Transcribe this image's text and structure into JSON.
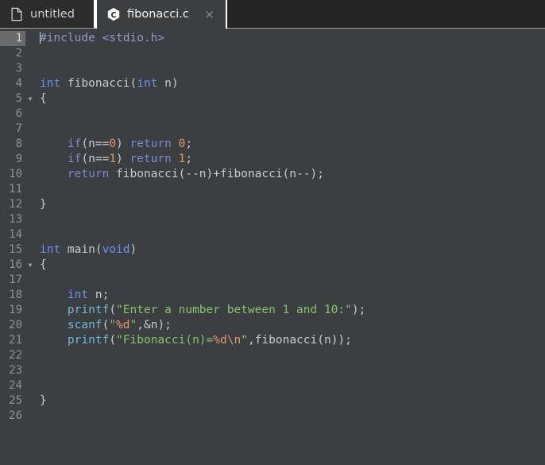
{
  "window": {
    "accent_white": "#ffffff",
    "tabbar_bg": "#252526",
    "editor_bg": "#3c3f41"
  },
  "tabs": [
    {
      "label": "untitled",
      "icon": "document-icon",
      "active": false,
      "has_close": false
    },
    {
      "label": "fibonacci.c",
      "icon": "c-file-hex-icon",
      "active": true,
      "has_close": true,
      "close_label": "×"
    }
  ],
  "editor": {
    "language": "c",
    "current_line": 1,
    "total_lines": 26,
    "cursor": {
      "line": 1,
      "column": 1
    },
    "fold_lines": [
      5,
      16
    ],
    "lines": [
      {
        "n": 1,
        "fold": false,
        "tokens": [
          {
            "t": "#include",
            "c": "pre"
          },
          {
            "t": " ",
            "c": "pl"
          },
          {
            "t": "<stdio.h>",
            "c": "pre"
          }
        ]
      },
      {
        "n": 2,
        "fold": false,
        "tokens": []
      },
      {
        "n": 3,
        "fold": false,
        "tokens": []
      },
      {
        "n": 4,
        "fold": false,
        "tokens": [
          {
            "t": "int",
            "c": "k"
          },
          {
            "t": " fibonacci(",
            "c": "pl"
          },
          {
            "t": "int",
            "c": "k"
          },
          {
            "t": " n)",
            "c": "pl"
          }
        ]
      },
      {
        "n": 5,
        "fold": true,
        "tokens": [
          {
            "t": "{",
            "c": "pl"
          }
        ]
      },
      {
        "n": 6,
        "fold": false,
        "tokens": []
      },
      {
        "n": 7,
        "fold": false,
        "tokens": []
      },
      {
        "n": 8,
        "fold": false,
        "tokens": [
          {
            "t": "    ",
            "c": "pl"
          },
          {
            "t": "if",
            "c": "kw"
          },
          {
            "t": "(n==",
            "c": "pl"
          },
          {
            "t": "0",
            "c": "num"
          },
          {
            "t": ") ",
            "c": "pl"
          },
          {
            "t": "return",
            "c": "kw"
          },
          {
            "t": " ",
            "c": "pl"
          },
          {
            "t": "0",
            "c": "num"
          },
          {
            "t": ";",
            "c": "pl"
          }
        ]
      },
      {
        "n": 9,
        "fold": false,
        "tokens": [
          {
            "t": "    ",
            "c": "pl"
          },
          {
            "t": "if",
            "c": "kw"
          },
          {
            "t": "(n==",
            "c": "pl"
          },
          {
            "t": "1",
            "c": "num"
          },
          {
            "t": ") ",
            "c": "pl"
          },
          {
            "t": "return",
            "c": "kw"
          },
          {
            "t": " ",
            "c": "pl"
          },
          {
            "t": "1",
            "c": "num"
          },
          {
            "t": ";",
            "c": "pl"
          }
        ]
      },
      {
        "n": 10,
        "fold": false,
        "tokens": [
          {
            "t": "    ",
            "c": "pl"
          },
          {
            "t": "return",
            "c": "kw"
          },
          {
            "t": " fibonacci(--n)+fibonacci(n--);",
            "c": "pl"
          }
        ]
      },
      {
        "n": 11,
        "fold": false,
        "tokens": []
      },
      {
        "n": 12,
        "fold": false,
        "tokens": [
          {
            "t": "}",
            "c": "pl"
          }
        ]
      },
      {
        "n": 13,
        "fold": false,
        "tokens": []
      },
      {
        "n": 14,
        "fold": false,
        "tokens": []
      },
      {
        "n": 15,
        "fold": false,
        "tokens": [
          {
            "t": "int",
            "c": "k"
          },
          {
            "t": " main(",
            "c": "pl"
          },
          {
            "t": "void",
            "c": "k"
          },
          {
            "t": ")",
            "c": "pl"
          }
        ]
      },
      {
        "n": 16,
        "fold": true,
        "tokens": [
          {
            "t": "{",
            "c": "pl"
          }
        ]
      },
      {
        "n": 17,
        "fold": false,
        "tokens": []
      },
      {
        "n": 18,
        "fold": false,
        "tokens": [
          {
            "t": "    ",
            "c": "pl"
          },
          {
            "t": "int",
            "c": "k"
          },
          {
            "t": " n;",
            "c": "pl"
          }
        ]
      },
      {
        "n": 19,
        "fold": false,
        "tokens": [
          {
            "t": "    ",
            "c": "pl"
          },
          {
            "t": "printf",
            "c": "fn"
          },
          {
            "t": "(",
            "c": "pl"
          },
          {
            "t": "\"Enter a number between 1 and 10:\"",
            "c": "str"
          },
          {
            "t": ");",
            "c": "pl"
          }
        ]
      },
      {
        "n": 20,
        "fold": false,
        "tokens": [
          {
            "t": "    ",
            "c": "pl"
          },
          {
            "t": "scanf",
            "c": "fn"
          },
          {
            "t": "(",
            "c": "pl"
          },
          {
            "t": "\"",
            "c": "str"
          },
          {
            "t": "%d",
            "c": "esc"
          },
          {
            "t": "\"",
            "c": "str"
          },
          {
            "t": ",&n);",
            "c": "pl"
          }
        ]
      },
      {
        "n": 21,
        "fold": false,
        "tokens": [
          {
            "t": "    ",
            "c": "pl"
          },
          {
            "t": "printf",
            "c": "fn"
          },
          {
            "t": "(",
            "c": "pl"
          },
          {
            "t": "\"Fibonacci(n)=",
            "c": "str"
          },
          {
            "t": "%d",
            "c": "esc"
          },
          {
            "t": "\\n",
            "c": "esc"
          },
          {
            "t": "\"",
            "c": "str"
          },
          {
            "t": ",fibonacci(n));",
            "c": "pl"
          }
        ]
      },
      {
        "n": 22,
        "fold": false,
        "tokens": []
      },
      {
        "n": 23,
        "fold": false,
        "tokens": []
      },
      {
        "n": 24,
        "fold": false,
        "tokens": []
      },
      {
        "n": 25,
        "fold": false,
        "tokens": [
          {
            "t": "}",
            "c": "pl"
          }
        ]
      },
      {
        "n": 26,
        "fold": false,
        "tokens": []
      }
    ]
  }
}
